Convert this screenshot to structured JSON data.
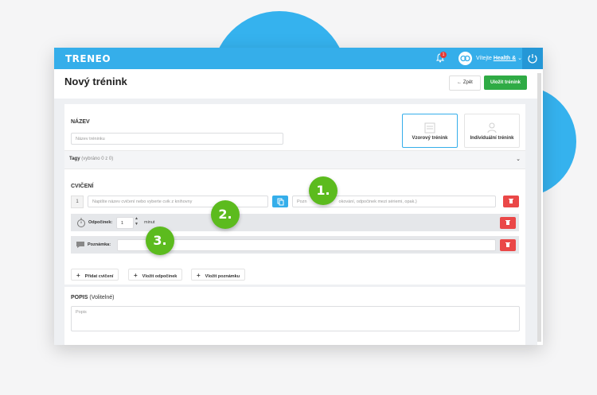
{
  "app": {
    "logo": "TRENEO",
    "notification_count": "1",
    "greeting": "Vítejte",
    "user_name": "Health &"
  },
  "header": {
    "title": "Nový trénink",
    "back_label": "Zpět",
    "save_label": "Uložit trénink"
  },
  "name_section": {
    "label": "NÁZEV",
    "placeholder": "Název tréninku"
  },
  "training_types": [
    {
      "label": "Vzorový trénink",
      "icon": "template-icon"
    },
    {
      "label": "Individuální trénink",
      "icon": "person-icon"
    }
  ],
  "tags": {
    "label": "Tagy",
    "count_text": "(vybráno 0 z 0)"
  },
  "exercises": {
    "label": "CVIČENÍ",
    "row_number": "1",
    "exercise_placeholder": "Napište název cvičení nebo vyberte cvik z knihovny",
    "note_placeholder_visible": "Pozn",
    "note_placeholder_rest": "okování, odpočinek mezi sériemi, opak.)",
    "rest_label": "Odpočinek:",
    "rest_value": "1",
    "rest_unit": "minut",
    "note_label": "Poznámka:"
  },
  "add_buttons": {
    "exercise": "Přidat cvičení",
    "rest": "Vložit odpočinek",
    "note": "Vložit poznámku"
  },
  "popis": {
    "label": "POPIS",
    "optional": "(Volitelné)",
    "placeholder": "Popis"
  },
  "steps": [
    "1.",
    "2.",
    "3."
  ],
  "colors": {
    "primary": "#35aeea",
    "success": "#2fab45",
    "danger": "#ea4848",
    "step": "#5cbb1e"
  }
}
